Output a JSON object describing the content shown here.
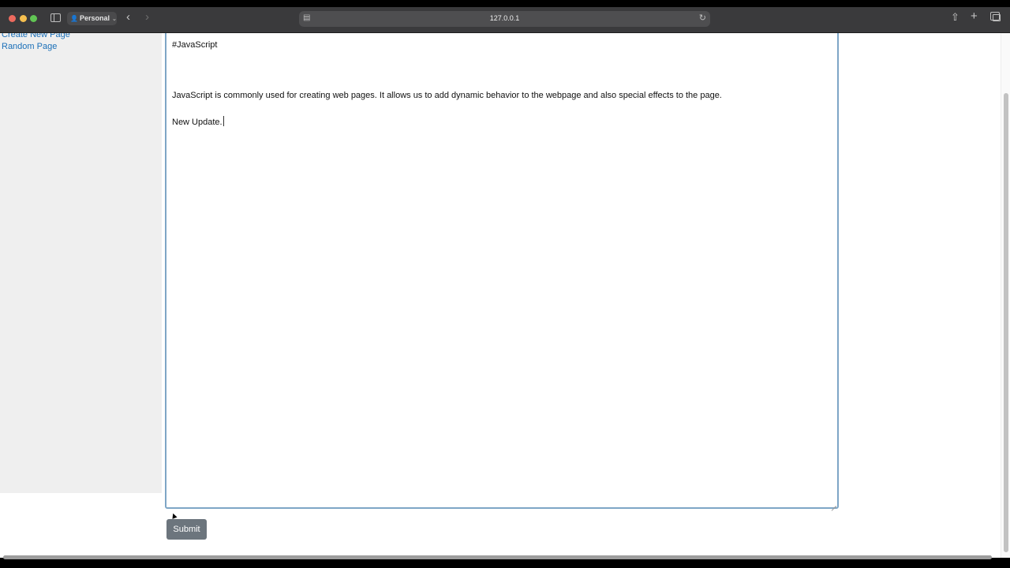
{
  "browser": {
    "profile_label": "Personal",
    "url": "127.0.0.1",
    "icons": {
      "close": "traffic-close",
      "minimize": "traffic-minimize",
      "zoom": "traffic-zoom",
      "sidebar": "sidebar-icon",
      "back": "chevron-left-icon",
      "forward": "chevron-right-icon",
      "reload": "reload-icon",
      "share": "share-icon",
      "new_tab": "plus-icon",
      "tabs": "tab-overview-icon"
    }
  },
  "sidebar": {
    "links": [
      {
        "label": "Create New Page"
      },
      {
        "label": "Random Page"
      }
    ]
  },
  "editor": {
    "lines": [
      "#JavaScript",
      "JavaScript is commonly used for creating web pages. It allows us to add dynamic behavior to the webpage and also special effects to the page.",
      "New Update."
    ]
  },
  "form": {
    "submit_label": "Submit"
  },
  "colors": {
    "link": "#1a6fb8",
    "submit_bg": "#6c757d",
    "editor_focus_border": "#7ea6c6",
    "sidebar_bg": "#efefef"
  }
}
